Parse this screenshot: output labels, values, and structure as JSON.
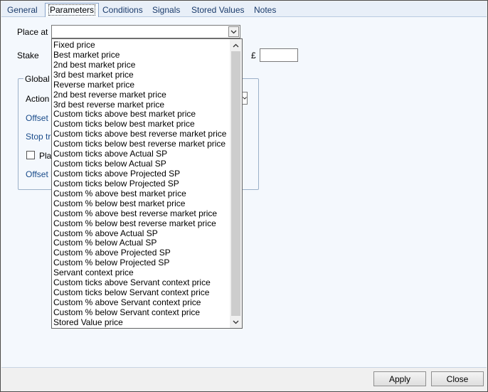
{
  "tabs": [
    {
      "label": "General"
    },
    {
      "label": "Parameters"
    },
    {
      "label": "Conditions"
    },
    {
      "label": "Signals"
    },
    {
      "label": "Stored Values"
    },
    {
      "label": "Notes"
    }
  ],
  "form": {
    "place_at_label": "Place at",
    "place_at_value": "",
    "stake_label": "Stake",
    "stake_currency": "£",
    "stake_value": "",
    "group_title": "Global",
    "action_label": "Action",
    "offset_label": "Offset",
    "stop_label": "Stop tri",
    "place_check_label": "Pla",
    "offset_b_label": "Offset b"
  },
  "dropdown": {
    "options": [
      "Fixed price",
      "Best market price",
      "2nd best market price",
      "3rd best market price",
      "Reverse market price",
      "2nd best reverse market price",
      "3rd best reverse market price",
      "Custom ticks above best market price",
      "Custom ticks below best market price",
      "Custom ticks above best reverse market price",
      "Custom ticks below best reverse market price",
      "Custom ticks above Actual SP",
      "Custom ticks below Actual SP",
      "Custom ticks above Projected SP",
      "Custom ticks below Projected SP",
      "Custom % above best market price",
      "Custom % below best market price",
      "Custom % above best reverse market price",
      "Custom % below best reverse market price",
      "Custom % above Actual SP",
      "Custom % below Actual SP",
      "Custom % above Projected SP",
      "Custom % below Projected SP",
      "Servant context price",
      "Custom ticks above Servant context price",
      "Custom ticks below Servant context price",
      "Custom % above Servant context price",
      "Custom % below Servant context price",
      "Stored Value price"
    ]
  },
  "buttons": {
    "apply": "Apply",
    "close": "Close"
  }
}
